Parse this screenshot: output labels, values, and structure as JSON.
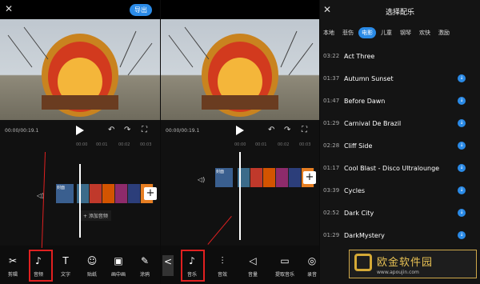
{
  "panel1": {
    "export_label": "导出",
    "timecode": "00:00/00:19.1",
    "ruler": [
      "00:00",
      "00:01",
      "00:02",
      "00:03"
    ],
    "clip_cover": "封面",
    "add_audio": "+ 添加音频",
    "tools": [
      {
        "icon": "scissors-icon",
        "glyph": "✂",
        "label": "剪辑"
      },
      {
        "icon": "music-note-icon",
        "glyph": "♪",
        "label": "音频"
      },
      {
        "icon": "text-icon",
        "glyph": "T",
        "label": "文字"
      },
      {
        "icon": "sticker-icon",
        "glyph": "☺",
        "label": "贴纸"
      },
      {
        "icon": "pip-icon",
        "glyph": "▣",
        "label": "画中画"
      },
      {
        "icon": "brush-icon",
        "glyph": "✎",
        "label": "涂鸦"
      }
    ]
  },
  "panel2": {
    "timecode": "00:00/00:19.1",
    "ruler": [
      "00:00",
      "00:01",
      "00:02",
      "00:03"
    ],
    "clip_cover": "封面",
    "back_glyph": "<",
    "tools": [
      {
        "icon": "music-note-icon",
        "glyph": "♪",
        "label": "音乐"
      },
      {
        "icon": "sound-effect-icon",
        "glyph": "⫶",
        "label": "音效"
      },
      {
        "icon": "volume-icon",
        "glyph": "◁",
        "label": "音量"
      },
      {
        "icon": "folder-icon",
        "glyph": "▭",
        "label": "提取音乐"
      },
      {
        "icon": "microphone-icon",
        "glyph": "◎",
        "label": "录音"
      }
    ]
  },
  "panel3": {
    "title": "选择配乐",
    "tabs": [
      {
        "label": "本地",
        "active": false
      },
      {
        "label": "悲伤",
        "active": false
      },
      {
        "label": "电影",
        "active": true
      },
      {
        "label": "儿童",
        "active": false
      },
      {
        "label": "钢琴",
        "active": false
      },
      {
        "label": "欢快",
        "active": false
      },
      {
        "label": "激励",
        "active": false
      }
    ],
    "songs": [
      {
        "duration": "03:22",
        "name": "Act Three",
        "download": false
      },
      {
        "duration": "01:37",
        "name": "Autumn Sunset",
        "download": true
      },
      {
        "duration": "01:47",
        "name": "Before Dawn",
        "download": true
      },
      {
        "duration": "01:29",
        "name": "Carnival De Brazil",
        "download": true
      },
      {
        "duration": "02:28",
        "name": "Cliff Side",
        "download": true
      },
      {
        "duration": "01:17",
        "name": "Cool Blast - Disco Ultralounge",
        "download": true
      },
      {
        "duration": "03:39",
        "name": "Cycles",
        "download": true
      },
      {
        "duration": "02:52",
        "name": "Dark City",
        "download": true
      },
      {
        "duration": "01:29",
        "name": "DarkMystery",
        "download": true
      }
    ]
  },
  "watermark": {
    "text": "欧金软件园",
    "url": "www.apoujin.com"
  },
  "colors": {
    "accent": "#2a8ae6",
    "highlight": "#e02020"
  }
}
